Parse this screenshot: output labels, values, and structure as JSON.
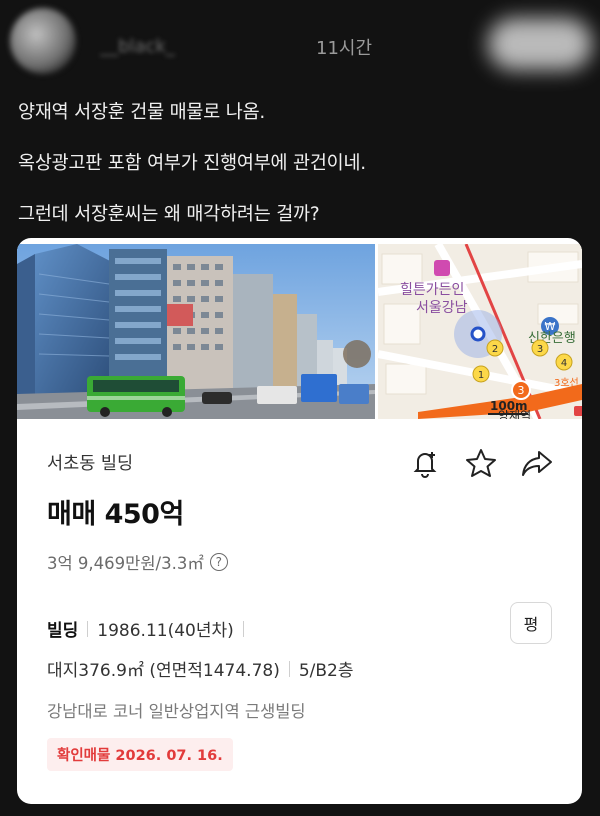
{
  "post": {
    "username": "__black_",
    "time": "11시간",
    "lines": [
      "양재역 서장훈 건물 매물로 나옴.",
      "옥상광고판 포함 여부가 진행여부에 관건이네.",
      "그런데 서장훈씨는 왜 매각하려는 걸까?"
    ]
  },
  "listing": {
    "name": "서초동 빌딩",
    "price": "매매 450억",
    "unit_price": "3억 9,469만원/3.3㎡",
    "type": "빌딩",
    "built": "1986.11(40년차)",
    "land": "대지376.9㎡ (연면적1474.78)",
    "floors": "5/B2층",
    "pyeong_label": "평",
    "description": "강남대로 코너 일반상업지역 근생빌딩",
    "confirm": "확인매물 2026. 07. 16."
  },
  "map": {
    "poi_name_line1": "힐튼가든인",
    "poi_name_line2": "서울강남",
    "bank_label": "신한은행",
    "station_label": "양재역",
    "scale": "100m",
    "exit_numbers": [
      "1",
      "2",
      "3",
      "4",
      "3"
    ],
    "exit_suffix": "3호선"
  },
  "colors": {
    "line3": "#f26a1b",
    "accent_red": "#e23b3b",
    "bus_green": "#3aaa35"
  }
}
